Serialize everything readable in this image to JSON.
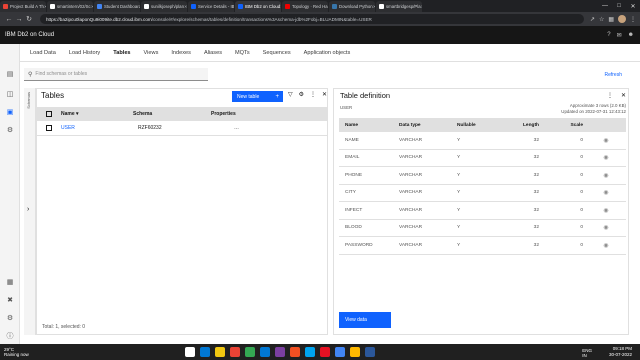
{
  "browser": {
    "tabs": [
      {
        "label": "Project Build A Th",
        "color": "#ea4335"
      },
      {
        "label": "smartintern/02/Sc",
        "color": "#ffffff"
      },
      {
        "label": "Student Dashboard",
        "color": "#4285f4"
      },
      {
        "label": "sunilkjoseph/plan",
        "color": "#ffffff"
      },
      {
        "label": "Service Details - IB",
        "color": "#0f62fe"
      },
      {
        "label": "IBM Db2 on Cloud",
        "color": "#0f62fe",
        "active": true
      },
      {
        "label": "Topology · Red Ha",
        "color": "#ee0000"
      },
      {
        "label": "Download Python",
        "color": "#3776ab"
      },
      {
        "label": "smartbridgesp/Pla",
        "color": "#ffffff"
      }
    ],
    "url_host": "https://ba2ipcu0laponQu9i009ite.db2.cloud.ibm.com",
    "url_path": "/console/#/explore/schemas/tables/definition/transactions%3Aschema-jdb%2Fobj=BLUADMIN&table=USER"
  },
  "app": {
    "title": "IBM Db2 on Cloud"
  },
  "subnav": [
    "Load Data",
    "Load History",
    "Tables",
    "Views",
    "Indexes",
    "Aliases",
    "MQTs",
    "Sequences",
    "Application objects"
  ],
  "subnav_selected": "Tables",
  "search": {
    "placeholder": "Find schemas or tables"
  },
  "refresh_label": "Refresh",
  "schemas_strip_label": "Schemas",
  "tables": {
    "title": "Tables",
    "new_label": "New table",
    "columns": [
      "Name",
      "Schema",
      "Properties"
    ],
    "rows": [
      {
        "name": "USER",
        "schema": "RZF60232",
        "properties": "…"
      }
    ],
    "footer": "Total: 1, selected: 0"
  },
  "definition": {
    "title": "Table definition",
    "table_name": "USER",
    "meta_line1": "Approximate 3 rows (2.0 KB)",
    "meta_line2": "Updated on 2022-07-31 12:43:12",
    "columns": [
      "Name",
      "Data type",
      "Nullable",
      "Length",
      "Scale"
    ],
    "rows": [
      {
        "name": "NAME",
        "type": "VARCHAR",
        "nullable": "Y",
        "length": "32",
        "scale": "0"
      },
      {
        "name": "EMAIL",
        "type": "VARCHAR",
        "nullable": "Y",
        "length": "32",
        "scale": "0"
      },
      {
        "name": "PHONE",
        "type": "VARCHAR",
        "nullable": "Y",
        "length": "32",
        "scale": "0"
      },
      {
        "name": "CITY",
        "type": "VARCHAR",
        "nullable": "Y",
        "length": "32",
        "scale": "0"
      },
      {
        "name": "INFECT",
        "type": "VARCHAR",
        "nullable": "Y",
        "length": "32",
        "scale": "0"
      },
      {
        "name": "BLOOD",
        "type": "VARCHAR",
        "nullable": "Y",
        "length": "32",
        "scale": "0"
      },
      {
        "name": "PASSWORD",
        "type": "VARCHAR",
        "nullable": "Y",
        "length": "32",
        "scale": "0"
      }
    ],
    "view_data_label": "View data"
  },
  "taskbar": {
    "temp": "29°C",
    "weather": "Raining now",
    "lang_top": "ENG",
    "lang_bottom": "IN",
    "time": "09:18 PM",
    "date": "30-07-2022",
    "app_colors": [
      "#ffffff",
      "#0078d4",
      "#f2c811",
      "#ea4335",
      "#34a853",
      "#0078d4",
      "#7b3fa0",
      "#f25022",
      "#00a4ef",
      "#e81123",
      "#4285f4",
      "#ffb900",
      "#2b579a"
    ]
  }
}
